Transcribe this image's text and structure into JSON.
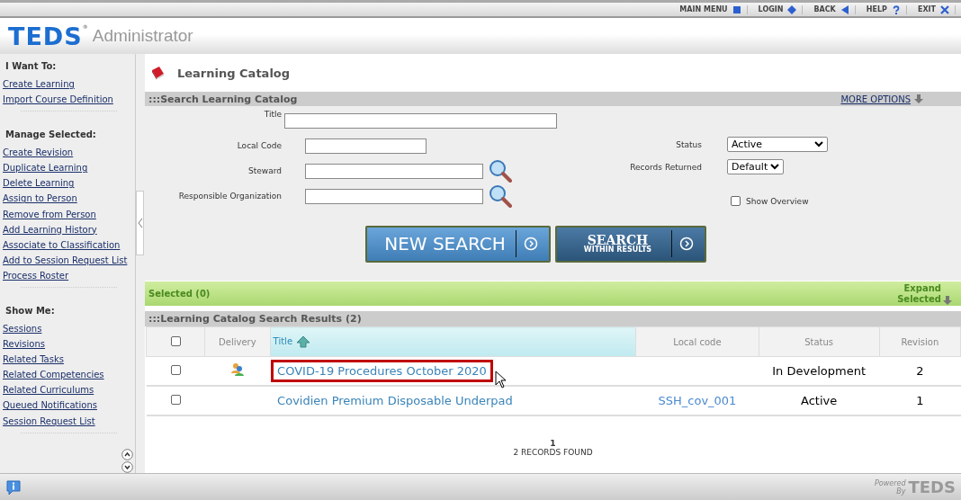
{
  "top_nav": [
    {
      "label": "MAIN MENU"
    },
    {
      "label": "LOGIN"
    },
    {
      "label": "BACK"
    },
    {
      "label": "HELP"
    },
    {
      "label": "EXIT"
    }
  ],
  "header": {
    "logo": "TEDS",
    "logo_mark": "®",
    "app_name": "Administrator"
  },
  "sidebar": {
    "sections": [
      {
        "heading": "I Want To:",
        "items": [
          "Create Learning",
          "Import Course Definition"
        ]
      },
      {
        "heading": "Manage Selected:",
        "items": [
          "Create Revision",
          "Duplicate Learning",
          "Delete Learning",
          "Assign to Person",
          "Remove from Person",
          "Add Learning History",
          "Associate to Classification",
          "Add to Session Request List",
          "Process Roster"
        ]
      },
      {
        "heading": "Show Me:",
        "items": [
          "Sessions",
          "Revisions",
          "Related Tasks",
          "Related Competencies",
          "Related Curriculums",
          "Queued Notifications",
          "Session Request List"
        ]
      }
    ]
  },
  "page_title": "Learning Catalog",
  "search": {
    "title": ":::Search Learning Catalog",
    "more_options": "MORE OPTIONS",
    "fields": [
      {
        "label": "Title",
        "kind": "wide"
      },
      {
        "label": "Local Code",
        "kind": "short"
      },
      {
        "label": "Steward",
        "kind": "lookup"
      },
      {
        "label": "Responsible Organization",
        "kind": "lookup"
      }
    ],
    "selects": [
      {
        "label": "Status",
        "value": "Active",
        "kind": "wide"
      },
      {
        "label": "Records Returned",
        "value": "Default",
        "kind": "short"
      }
    ],
    "show_overview": {
      "label": "Show Overview",
      "checked": false
    },
    "buttons": [
      {
        "label": "NEW SEARCH"
      },
      {
        "label": "SEARCH",
        "sublabel": "WITHIN RESULTS"
      }
    ]
  },
  "selected_bar": {
    "label": "Selected (0)",
    "expand": "Expand Selected"
  },
  "results": {
    "title": ":::Learning Catalog Search Results (2)",
    "select_all": {
      "checked": false
    },
    "columns": [
      {
        "label": "Delivery",
        "sorted": false
      },
      {
        "label": "Title",
        "sorted": true
      },
      {
        "label": "Local code",
        "sorted": false
      },
      {
        "label": "Status",
        "sorted": false
      },
      {
        "label": "Revision",
        "sorted": false
      }
    ],
    "rows": [
      {
        "checked": false,
        "has_delivery": true,
        "title": "COVID-19 Procedures October 2020",
        "status": "In Development",
        "revision": "2",
        "highlighted": true
      },
      {
        "checked": false,
        "has_delivery": false,
        "title": "Covidien Premium Disposable Underpad",
        "local_code": "SSH_cov_001",
        "status": "Active",
        "revision": "1",
        "highlighted": false
      }
    ],
    "page": "1",
    "records_found": "2 RECORDS FOUND"
  },
  "footer": {
    "powered": "Powered By",
    "logo": "TEDS"
  }
}
